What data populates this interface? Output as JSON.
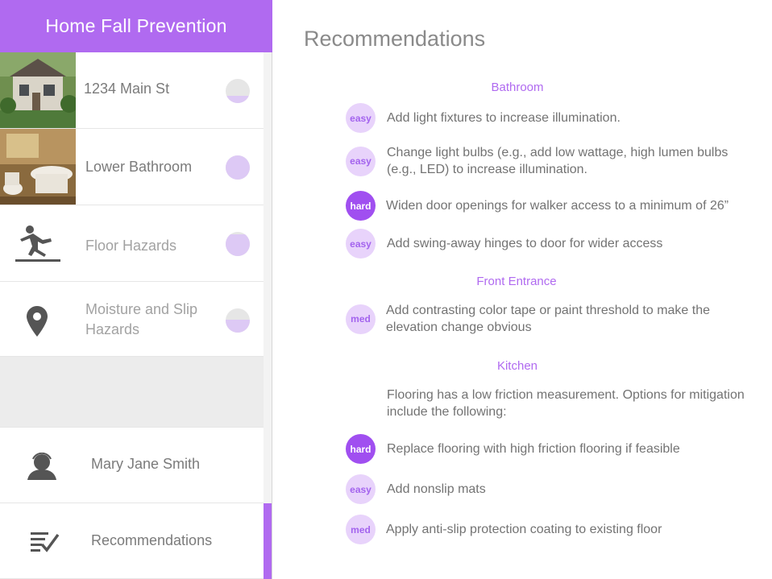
{
  "app": {
    "title": "Home Fall Prevention"
  },
  "sidebar": {
    "items": [
      {
        "label": "1234 Main St",
        "progress": 0.3
      },
      {
        "label": "Lower Bathroom",
        "progress": 1.0
      },
      {
        "label": "Floor Hazards",
        "progress": 0.9
      },
      {
        "label": "Moisture and Slip Hazards",
        "progress": 0.55
      }
    ],
    "user": {
      "label": "Mary Jane Smith"
    },
    "recommendations": {
      "label": "Recommendations"
    }
  },
  "main": {
    "title": "Recommendations",
    "sections": [
      {
        "title": "Bathroom",
        "items": [
          {
            "difficulty": "easy",
            "text": "Add light fixtures to increase illumination."
          },
          {
            "difficulty": "easy",
            "text": "Change light bulbs (e.g., add low wattage, high lumen bulbs (e.g., LED) to increase illumination."
          },
          {
            "difficulty": "hard",
            "text": "Widen door openings for walker access to a minimum of 26”"
          },
          {
            "difficulty": "easy",
            "text": "Add swing-away hinges to door for wider access"
          }
        ]
      },
      {
        "title": "Front Entrance",
        "items": [
          {
            "difficulty": "med",
            "text": "Add contrasting color tape or paint threshold to make the elevation change obvious"
          }
        ]
      },
      {
        "title": "Kitchen",
        "note": "Flooring has a low friction measurement. Options for mitigation include the following:",
        "items": [
          {
            "difficulty": "hard",
            "text": "Replace flooring with high friction flooring if feasible"
          },
          {
            "difficulty": "easy",
            "text": "Add nonslip mats"
          },
          {
            "difficulty": "med",
            "text": "Apply anti-slip protection coating to existing floor"
          }
        ]
      }
    ]
  },
  "colors": {
    "accent": "#b06af0",
    "badge_light": "#e8d3fb",
    "badge_dark": "#a04ff0"
  }
}
